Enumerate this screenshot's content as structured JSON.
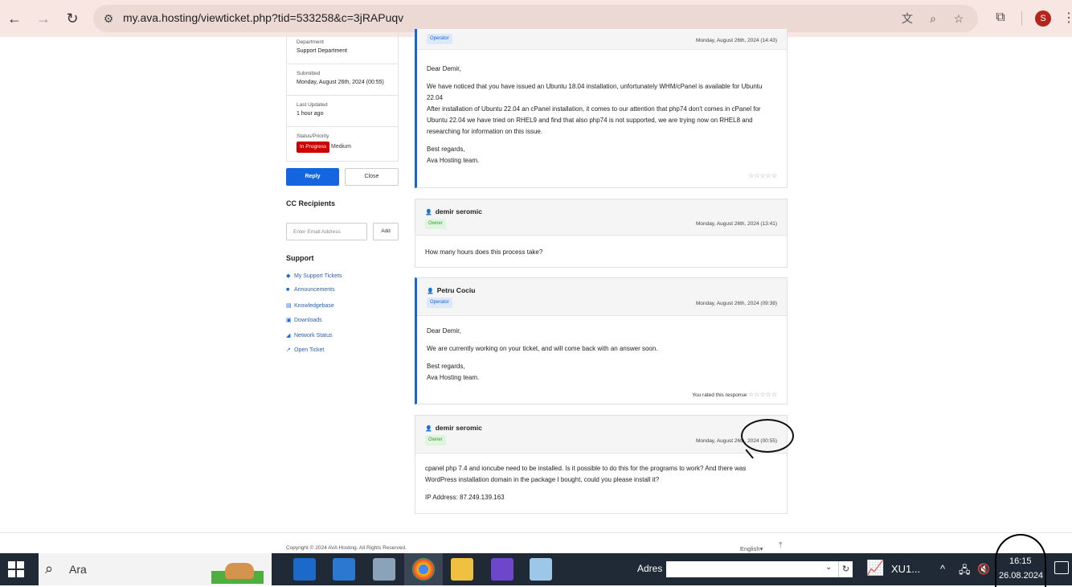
{
  "browser": {
    "url": "my.ava.hosting/viewticket.php?tid=533258&c=3jRAPuqv",
    "profile_initial": "S"
  },
  "sidebar": {
    "department_label": "Department",
    "department_value": "Support Department",
    "submitted_label": "Submitted",
    "submitted_value": "Monday, August 26th, 2024 (00:55)",
    "updated_label": "Last Updated",
    "updated_value": "1 hour ago",
    "status_label": "Status/Priority",
    "status_value": "In Progress",
    "priority_value": "Medium",
    "reply_label": "Reply",
    "close_label": "Close",
    "cc_heading": "CC Recipients",
    "email_placeholder": "Enter Email Address",
    "add_label": "Add",
    "support_heading": "Support",
    "support_links": [
      "My Support Tickets",
      "Announcements",
      "Knowledgebase",
      "Downloads",
      "Network Status",
      "Open Ticket"
    ]
  },
  "messages": [
    {
      "role": "Operator",
      "date": "Monday, August 26th, 2024 (14:43)",
      "greeting": "Dear Demir,",
      "para1": "We have noticed that you have issued an Ubuntu 18.04 installation, unfortunately WHM/cPanel is available for Ubuntu 22.04",
      "para2": "After installation of Ubuntu 22.04 an cPanel installation, it comes to our attention that php74 don't comes in cPanel for Ubuntu 22.04 we have tried on RHEL9 and find that also php74 is not supported, we are trying now on RHEL8 and researching for information on this issue.",
      "signoff1": "Best regards,",
      "signoff2": "Ava Hosting team.",
      "stars": "☆☆☆☆☆"
    },
    {
      "name": "demir seromic",
      "role": "Owner",
      "date": "Monday, August 26th, 2024 (13:41)",
      "body": "How many hours does this process take?"
    },
    {
      "name": "Petru Cociu",
      "role": "Operator",
      "date": "Monday, August 26th, 2024 (09:38)",
      "greeting": "Dear Demir,",
      "para1": "We are currently working on your ticket, and will come back with an answer soon.",
      "signoff1": "Best regards,",
      "signoff2": "Ava Hosting team.",
      "rated_label": "You rated this response",
      "stars": "☆☆☆☆☆"
    },
    {
      "name": "demir seromic",
      "role": "Owner",
      "date": "Monday, August 26th, 2024 (00:55)",
      "para1": "cpanel php 7.4 and ioncube need to be installed. Is it possible to do this for the programs to work? And there was WordPress installation domain in the package I bought, could you please install it?",
      "ip": "IP Address: 87.249.139.163"
    }
  ],
  "footer": {
    "copyright": "Copyright © 2024 AVA Hosting. All Rights Reserved.",
    "language": "English"
  },
  "taskbar": {
    "search_text": "Ara",
    "address_label": "Adres",
    "app_label": "XU1...",
    "time": "16:15",
    "date": "26.08.2024"
  }
}
